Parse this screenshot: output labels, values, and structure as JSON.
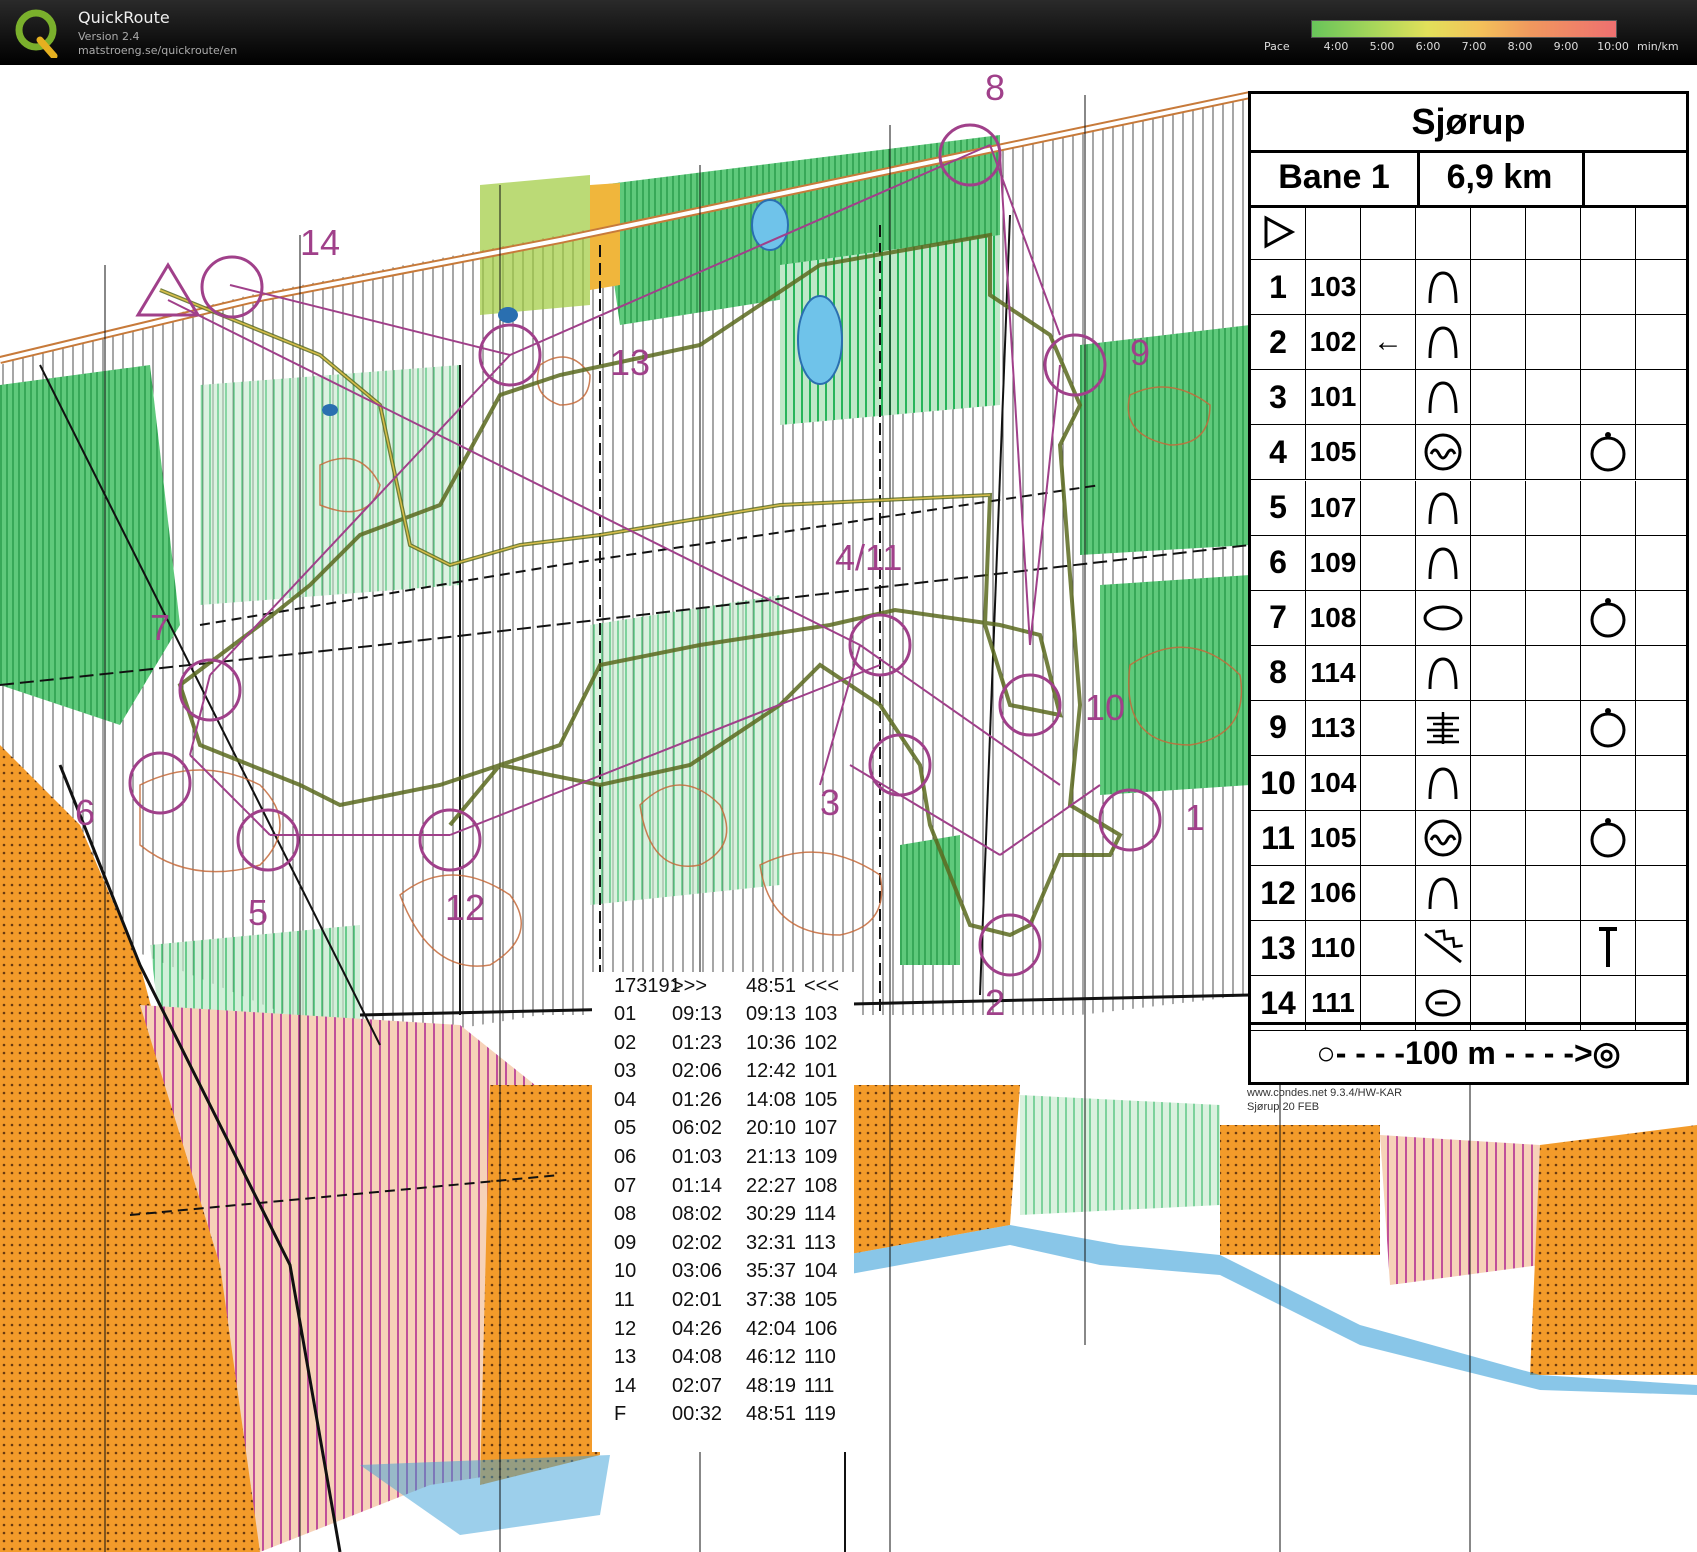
{
  "app": {
    "name": "QuickRoute",
    "version": "Version 2.4",
    "url": "matstroeng.se/quickroute/en",
    "logo_letter": "Q",
    "logo_icon": "quickroute-q-logo-icon",
    "accent": "#7ab02c"
  },
  "pace_scale": {
    "label": "Pace",
    "ticks": [
      "4:00",
      "5:00",
      "6:00",
      "7:00",
      "8:00",
      "9:00",
      "10:00"
    ],
    "unit": "min/km"
  },
  "map": {
    "control_numbers": [
      "8",
      "14",
      "13",
      "9",
      "4/11",
      "10",
      "7",
      "6",
      "3",
      "1",
      "5",
      "12",
      "2"
    ],
    "colors": {
      "forest": "#27b45a",
      "open": "#f39b2a",
      "route": "#5a6a1e",
      "course": "#a0408a",
      "contour": "#c56a3a"
    }
  },
  "legend": {
    "title": "Sjørup",
    "course_name": "Bane 1",
    "course_length": "6,9 km",
    "start_symbol": "start-triangle-icon",
    "rows": [
      {
        "num": "1",
        "code": "103",
        "arrow": "",
        "feature": "knoll-icon",
        "mark": ""
      },
      {
        "num": "2",
        "code": "102",
        "arrow": "←",
        "feature": "knoll-icon",
        "mark": ""
      },
      {
        "num": "3",
        "code": "101",
        "arrow": "",
        "feature": "knoll-icon",
        "mark": ""
      },
      {
        "num": "4",
        "code": "105",
        "arrow": "",
        "feature": "depression-icon",
        "mark": "circle-dot-icon"
      },
      {
        "num": "5",
        "code": "107",
        "arrow": "",
        "feature": "knoll-icon",
        "mark": ""
      },
      {
        "num": "6",
        "code": "109",
        "arrow": "",
        "feature": "knoll-icon",
        "mark": ""
      },
      {
        "num": "7",
        "code": "108",
        "arrow": "",
        "feature": "oval-icon",
        "mark": "circle-dot-icon"
      },
      {
        "num": "8",
        "code": "114",
        "arrow": "",
        "feature": "knoll-icon",
        "mark": ""
      },
      {
        "num": "9",
        "code": "113",
        "arrow": "",
        "feature": "marsh-icon",
        "mark": "circle-dot-icon"
      },
      {
        "num": "10",
        "code": "104",
        "arrow": "",
        "feature": "knoll-icon",
        "mark": ""
      },
      {
        "num": "11",
        "code": "105",
        "arrow": "",
        "feature": "depression-icon",
        "mark": "circle-dot-icon"
      },
      {
        "num": "12",
        "code": "106",
        "arrow": "",
        "feature": "knoll-icon",
        "mark": ""
      },
      {
        "num": "13",
        "code": "110",
        "arrow": "",
        "feature": "ditch-icon",
        "mark": "foot-icon"
      },
      {
        "num": "14",
        "code": "111",
        "arrow": "",
        "feature": "pit-icon",
        "mark": ""
      }
    ],
    "footer": "○- - - -100 m - - - ->◎",
    "credit": "www.condes.net 9.3.4/HW-KAR",
    "event": "Sjørup 20 FEB"
  },
  "splits": {
    "header": [
      "173191",
      ">>>",
      "48:51",
      "<<<"
    ],
    "rows": [
      [
        "01",
        "09:13",
        "09:13",
        "103"
      ],
      [
        "02",
        "01:23",
        "10:36",
        "102"
      ],
      [
        "03",
        "02:06",
        "12:42",
        "101"
      ],
      [
        "04",
        "01:26",
        "14:08",
        "105"
      ],
      [
        "05",
        "06:02",
        "20:10",
        "107"
      ],
      [
        "06",
        "01:03",
        "21:13",
        "109"
      ],
      [
        "07",
        "01:14",
        "22:27",
        "108"
      ],
      [
        "08",
        "08:02",
        "30:29",
        "114"
      ],
      [
        "09",
        "02:02",
        "32:31",
        "113"
      ],
      [
        "10",
        "03:06",
        "35:37",
        "104"
      ],
      [
        "11",
        "02:01",
        "37:38",
        "105"
      ],
      [
        "12",
        "04:26",
        "42:04",
        "106"
      ],
      [
        "13",
        "04:08",
        "46:12",
        "110"
      ],
      [
        "14",
        "02:07",
        "48:19",
        "111"
      ],
      [
        "F",
        "00:32",
        "48:51",
        "119"
      ]
    ]
  }
}
